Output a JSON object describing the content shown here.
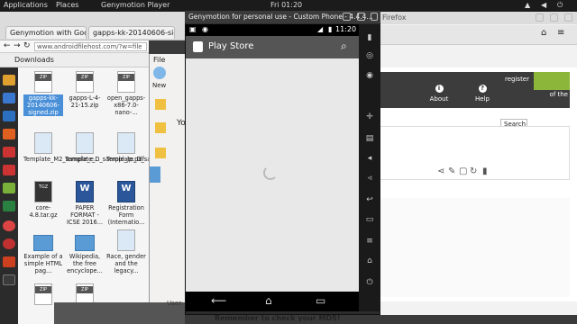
{
  "topbar": {
    "applications": "Applications",
    "places": "Places",
    "app_name": "Genymotion Player",
    "clock": "Fri 01:20"
  },
  "chrome": {
    "tabs": [
      "Genymotion with Goo...",
      "gapps-kk-20140606-sign..."
    ],
    "url": "www.androidfilehost.com/?w=file"
  },
  "file_manager": {
    "downloads_label": "Downloads",
    "files": [
      {
        "name": "gapps-kk-20140606-signed.zip",
        "type": "zip",
        "selected": true
      },
      {
        "name": "gapps-L-4-21-15.zip",
        "type": "zip"
      },
      {
        "name": "open_gapps-x86-7.0-nano-...",
        "type": "zip"
      },
      {
        "name": "Template_M2_sample_e...",
        "type": "img"
      },
      {
        "name": "Template_D_sample_jp.pdf",
        "type": "img"
      },
      {
        "name": "Template_D_sample_eng.pdf",
        "type": "img"
      },
      {
        "name": "core-4.8.tar.gz",
        "type": "tgz"
      },
      {
        "name": "PAPER FORMAT - ICSE 2016...",
        "type": "doc"
      },
      {
        "name": "Registration Form (Internatio...",
        "type": "doc"
      },
      {
        "name": "Example of a simple HTML pag...",
        "type": "folder"
      },
      {
        "name": "Wikipedia, the free encyclope...",
        "type": "folder"
      },
      {
        "name": "Race, gender and the legacy...",
        "type": "img"
      }
    ]
  },
  "middle_window": {
    "file_label": "File",
    "new_label": "New",
    "you_label": "You"
  },
  "firefox": {
    "title": "Firefox",
    "register": "register",
    "of_the": "of the",
    "nav": [
      {
        "icon": "i",
        "label": "About"
      },
      {
        "icon": "?",
        "label": "Help"
      }
    ],
    "search_label": "Search",
    "md5_note": "Remember to check your MD5!",
    "status_text": "User: fa... free for personal use"
  },
  "genymotion": {
    "window_title": "Genymotion for personal use - Custom Phone - 4.4.4...",
    "time": "11:20",
    "app_title": "Play Store",
    "toolbar_icons": [
      "battery-icon",
      "gps-icon",
      "camera-icon",
      "move-icon",
      "id-icon",
      "volume-up-icon",
      "volume-down-icon",
      "back-icon",
      "menu-icon",
      "home-icon",
      "power-icon"
    ]
  }
}
